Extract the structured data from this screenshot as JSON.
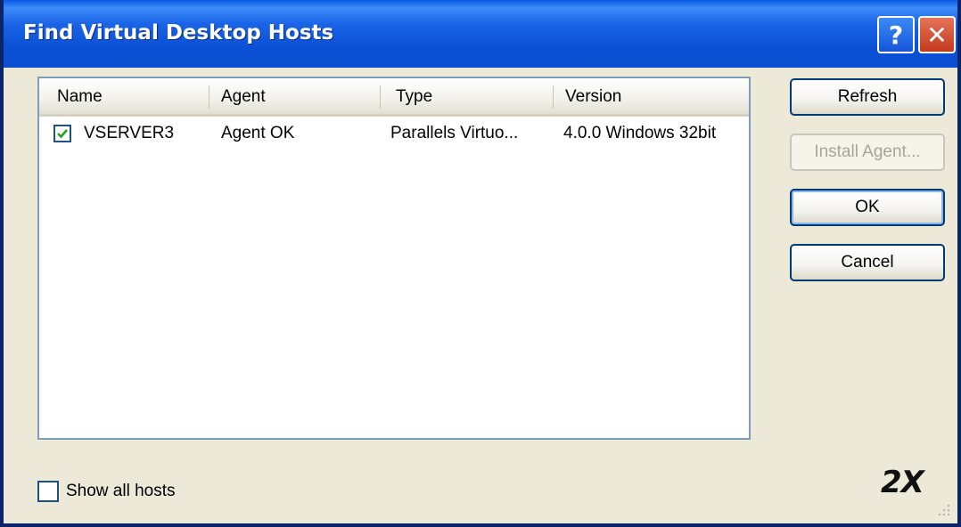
{
  "window": {
    "title": "Find Virtual Desktop Hosts",
    "help_glyph": "?",
    "close_glyph": "✕"
  },
  "list": {
    "columns": [
      "Name",
      "Agent",
      "Type",
      "Version"
    ],
    "rows": [
      {
        "checked": true,
        "name": "VSERVER3",
        "agent": "Agent OK",
        "type": "Parallels Virtuo...",
        "version": "4.0.0 Windows 32bit"
      }
    ]
  },
  "buttons": {
    "refresh": "Refresh",
    "install_agent": "Install Agent...",
    "ok": "OK",
    "cancel": "Cancel"
  },
  "show_all": {
    "label": "Show all hosts",
    "checked": false
  },
  "logo": {
    "text": "2X"
  },
  "colors": {
    "titlebar": "#0a5ae8",
    "close": "#d8502f",
    "accent": "#7f9db9"
  }
}
